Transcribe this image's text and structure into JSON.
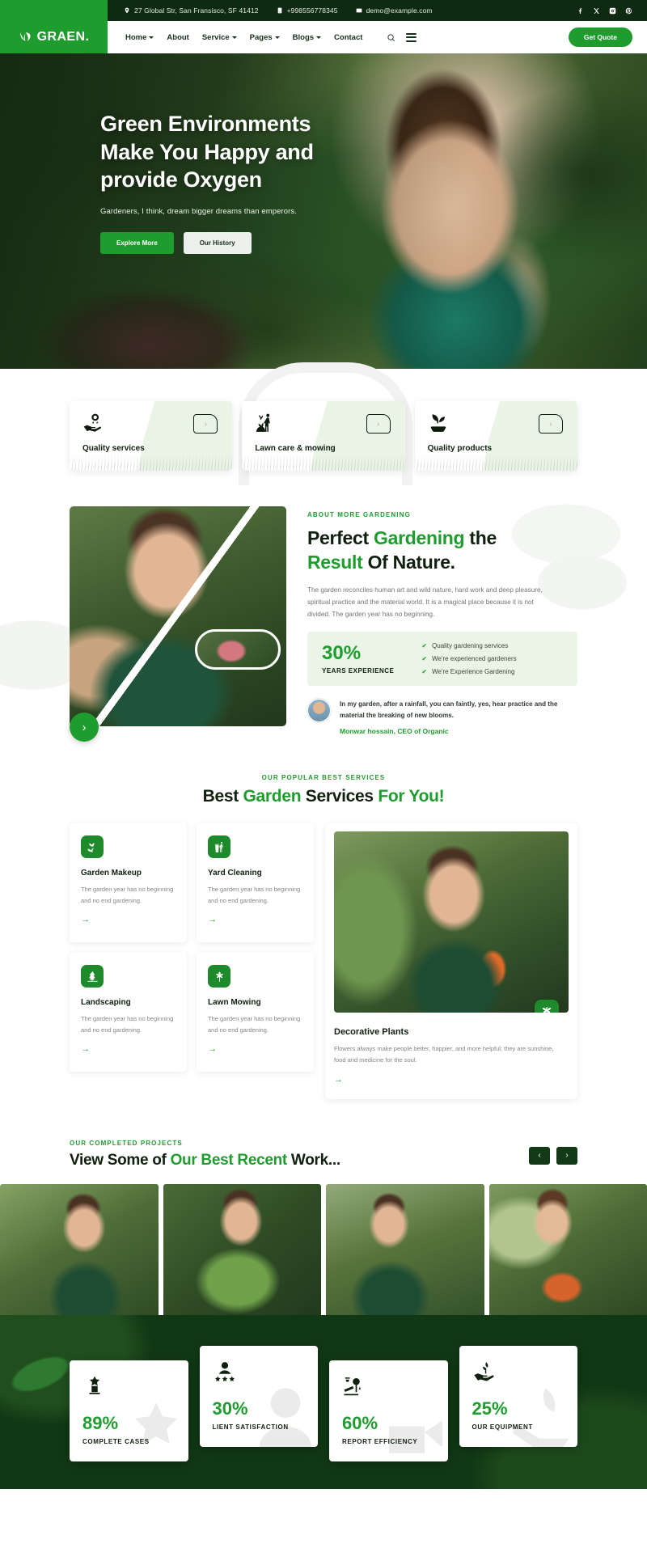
{
  "topbar": {
    "address": "27 Global Str, San Fransisco, SF 41412",
    "phone": "+998556778345",
    "email": "demo@example.com",
    "social": [
      "facebook-icon",
      "x-twitter-icon",
      "instagram-icon",
      "pinterest-icon"
    ]
  },
  "brand": {
    "name": "GRAEN."
  },
  "nav": {
    "items": [
      {
        "label": "Home",
        "has_dropdown": true
      },
      {
        "label": "About",
        "has_dropdown": false
      },
      {
        "label": "Service",
        "has_dropdown": true
      },
      {
        "label": "Pages",
        "has_dropdown": true
      },
      {
        "label": "Blogs",
        "has_dropdown": true
      },
      {
        "label": "Contact",
        "has_dropdown": false
      }
    ],
    "cta": "Get Quote"
  },
  "hero": {
    "title_line1": "Green Environments",
    "title_line2": "Make You Happy and",
    "title_line3": "provide Oxygen",
    "subtitle": "Gardeners, I think, dream bigger dreams than emperors.",
    "btn_primary": "Explore More",
    "btn_secondary": "Our History"
  },
  "features": [
    {
      "title": "Quality services",
      "icon": "award-hand-icon"
    },
    {
      "title": "Lawn care & mowing",
      "icon": "gardener-icon"
    },
    {
      "title": "Quality products",
      "icon": "sprout-icon"
    }
  ],
  "about": {
    "eyebrow": "ABOUT MORE GARDENING",
    "heading_1": "Perfect ",
    "heading_green_1": "Gardening",
    "heading_2": " the",
    "heading_green_2": "Result",
    "heading_3": " Of Nature.",
    "paragraph": "The garden reconciles human art and wild nature, hard work and deep pleasure, spiritual practice and the material world. It is a magical place because it is not divided. The garden year has no beginning.",
    "stat_number": "30%",
    "stat_label": "YEARS EXPERIENCE",
    "checks": [
      "Quality gardening services",
      "We're experienced gardeners",
      "We're Experience Gardening"
    ],
    "quote": "In my garden, after a rainfall, you can faintly, yes, hear practice and the material the breaking of new blooms.",
    "quote_author": "Monwar hossain, CEO of Organic"
  },
  "services": {
    "eyebrow": "OUR POPULAR BEST SERVICES",
    "heading_1": "Best ",
    "heading_green_1": "Garden",
    "heading_2": " Services ",
    "heading_green_2": "For You!",
    "cards": [
      {
        "title": "Garden Makeup",
        "desc": "The garden year has no beginning and no end gardening.",
        "icon": "leaf-sprout-icon",
        "arrow": "→"
      },
      {
        "title": "Yard Cleaning",
        "desc": "The garden year has no beginning and no end gardening.",
        "icon": "trash-person-icon",
        "arrow": "→"
      },
      {
        "title": "Landscaping",
        "desc": "The garden year has no beginning and no end gardening.",
        "icon": "tree-landscape-icon",
        "arrow": "→"
      },
      {
        "title": "Lawn Mowing",
        "desc": "The garden year has no beginning and no end gardening.",
        "icon": "grass-mow-icon",
        "arrow": "→"
      }
    ],
    "feature": {
      "title": "Decorative Plants",
      "desc": "Flowers always make people better, happier, and more helpful; they are sunshine, food and medicine for the soul.",
      "badge_icon": "palm-plant-icon",
      "arrow": "→"
    }
  },
  "projects": {
    "eyebrow": "OUR COMPLETED PROJECTS",
    "heading_1": "View Some of ",
    "heading_green": "Our Best Recent",
    "heading_2": " Work...",
    "prev": "‹",
    "next": "›",
    "items": [
      "project-thumb-1",
      "project-thumb-2",
      "project-thumb-3",
      "project-thumb-4"
    ]
  },
  "counters": [
    {
      "value": "89%",
      "label": "COMPLETE CASES",
      "icon": "trophy-star-icon"
    },
    {
      "value": "30%",
      "label": "LIENT SATISFACTION",
      "icon": "person-stars-icon"
    },
    {
      "value": "60%",
      "label": "REPORT EFFICIENCY",
      "icon": "watering-plant-icon"
    },
    {
      "value": "25%",
      "label": "OUR EQUIPMENT",
      "icon": "hand-sprout-icon"
    }
  ],
  "colors": {
    "brand_green": "#1f9c2e",
    "dark_green": "#113814",
    "topbar_dark": "#0f2a12"
  }
}
